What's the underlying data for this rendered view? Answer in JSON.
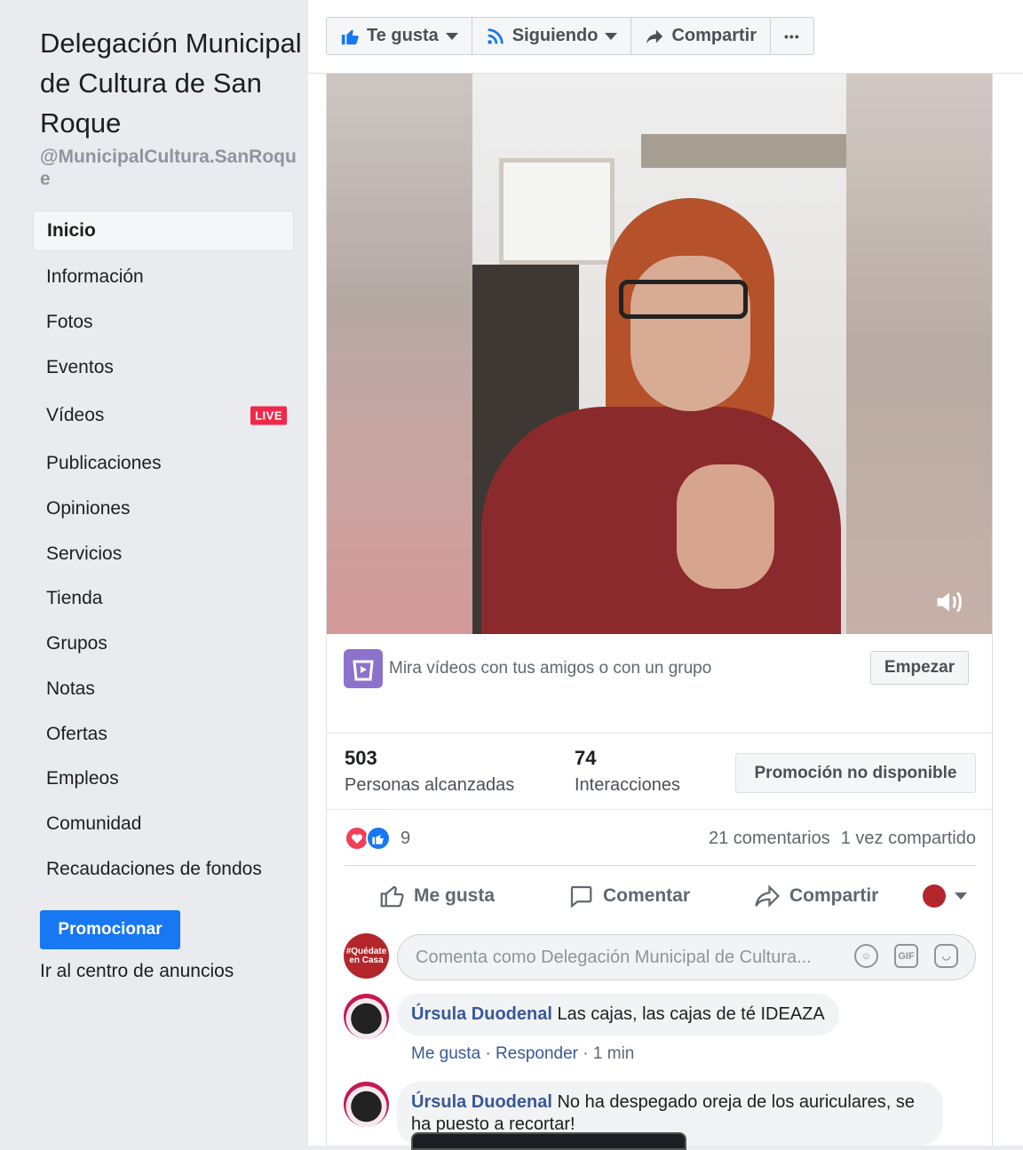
{
  "sidebar": {
    "page_name": "Delegación Municipal de Cultura de San Roque",
    "page_handle": "@MunicipalCultura.SanRoque",
    "nav": [
      {
        "label": "Inicio"
      },
      {
        "label": "Información"
      },
      {
        "label": "Fotos"
      },
      {
        "label": "Eventos"
      },
      {
        "label": "Vídeos",
        "badge": "LIVE"
      },
      {
        "label": "Publicaciones"
      },
      {
        "label": "Opiniones"
      },
      {
        "label": "Servicios"
      },
      {
        "label": "Tienda"
      },
      {
        "label": "Grupos"
      },
      {
        "label": "Notas"
      },
      {
        "label": "Ofertas"
      },
      {
        "label": "Empleos"
      },
      {
        "label": "Comunidad"
      },
      {
        "label": "Recaudaciones de fondos"
      }
    ],
    "promote_label": "Promocionar",
    "ads_center_label": "Ir al centro de anuncios"
  },
  "topbar": {
    "like_label": "Te gusta",
    "following_label": "Siguiendo",
    "share_label": "Compartir",
    "more_label": "•••"
  },
  "post": {
    "watch_party_text": "Mira vídeos con tus amigos o con un grupo",
    "start_label": "Empezar",
    "reach_count": "503",
    "reach_label": "Personas alcanzadas",
    "engagement_count": "74",
    "engagement_label": "Interacciones",
    "promo_unavailable": "Promoción no disponible",
    "reaction_count": "9",
    "comments_count": "21 comentarios",
    "shares_count": "1 vez compartido",
    "action_like": "Me gusta",
    "action_comment": "Comentar",
    "action_share": "Compartir",
    "composer_avatar_text": "#Quédate en Casa",
    "composer_placeholder": "Comenta como Delegación Municipal de Cultura..."
  },
  "comments": [
    {
      "author": "Úrsula Duodenal",
      "text": "Las cajas, las cajas de té IDEAZA",
      "like": "Me gusta",
      "reply": "Responder",
      "time": "1 min"
    },
    {
      "author": "Úrsula Duodenal",
      "text": "No ha despegado oreja de los auriculares, se ha puesto a recortar!"
    }
  ],
  "colors": {
    "brand_blue": "#1877f2",
    "live_red": "#f02849",
    "link_blue": "#385898",
    "sidebar_bg": "#e9ebee"
  },
  "icons": [
    "thumbs-up-icon",
    "rss-icon",
    "share-arrow-icon",
    "more-icon",
    "volume-icon",
    "watch-party-icon",
    "love-reaction-icon",
    "like-reaction-icon",
    "comment-bubble-icon",
    "emoji-icon",
    "gif-icon",
    "sticker-icon"
  ]
}
